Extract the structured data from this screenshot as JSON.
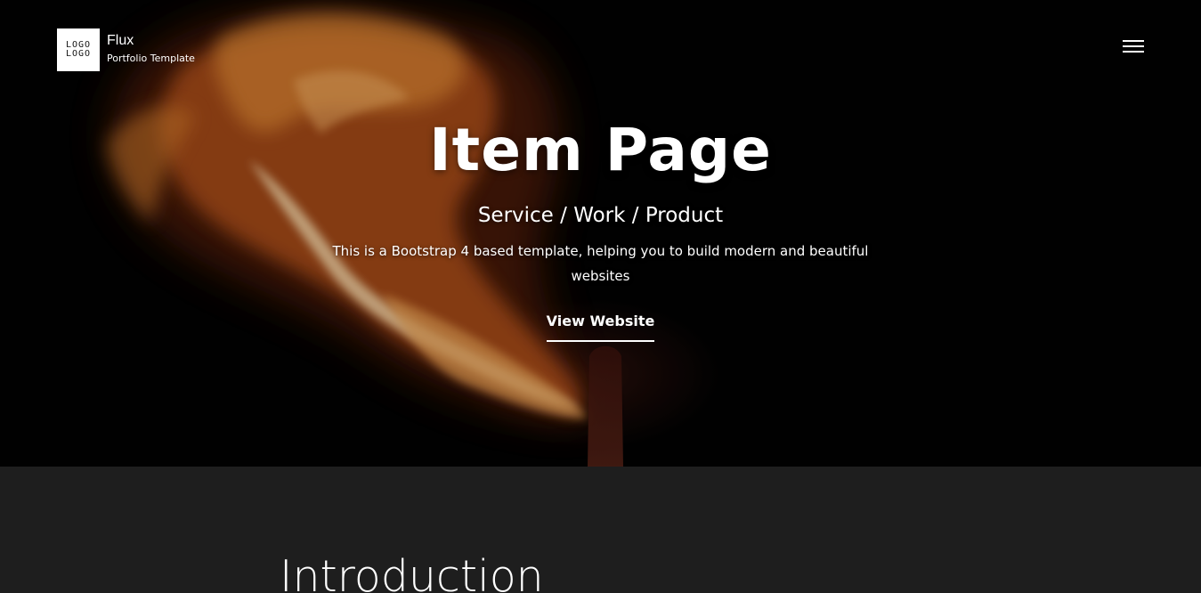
{
  "brand": {
    "logo_text": "LOGO LOGO",
    "title": "Flux",
    "subtitle": "Portfolio Template"
  },
  "nav": {
    "menu_icon": "hamburger-menu-icon"
  },
  "hero": {
    "background_image": "burning-match-flame-photo",
    "title": "Item Page",
    "subtitle": "Service / Work / Product",
    "description": "This is a Bootstrap 4 based template, helping you to build modern and beautiful websites",
    "link_label": "View Website"
  },
  "intro": {
    "title": "Introduction"
  },
  "colors": {
    "hero_background": "#020202",
    "section_background": "#1e1e1e",
    "text": "#ffffff"
  }
}
